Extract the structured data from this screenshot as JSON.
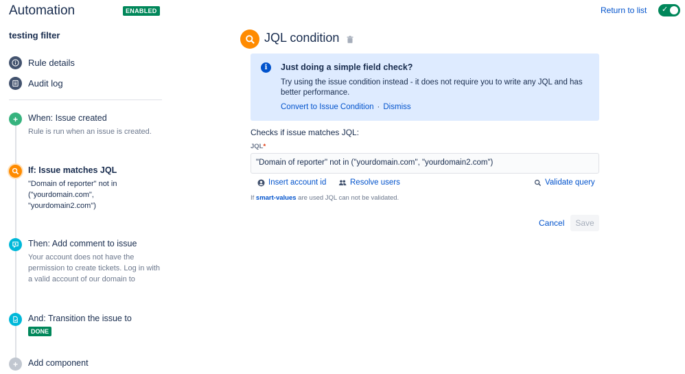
{
  "header": {
    "title": "Automation",
    "status_badge": "ENABLED",
    "return_link": "Return to list",
    "toggle_on": true
  },
  "rule": {
    "name": "testing filter"
  },
  "nav": {
    "items": [
      {
        "label": "Rule details",
        "icon": "info-icon"
      },
      {
        "label": "Audit log",
        "icon": "list-icon"
      }
    ]
  },
  "timeline": {
    "steps": [
      {
        "title": "When: Issue created",
        "desc": "Rule is run when an issue is created.",
        "icon": "plus-icon",
        "color": "#36b37e"
      },
      {
        "title": "If: Issue matches JQL",
        "desc": "\"Domain of reporter\" not in (\"yourdomain.com\", \"yourdomain2.com\")",
        "icon": "search-icon",
        "color": "#ff8b00"
      },
      {
        "title": "Then: Add comment to issue",
        "desc": "Your account does not have the permission to create tickets. Log in with a valid account of our domain to",
        "icon": "comment-icon",
        "color": "#00b8d9"
      },
      {
        "title": "And: Transition the issue to",
        "badge": "DONE",
        "icon": "document-icon",
        "color": "#00b8d9"
      },
      {
        "title": "Add component",
        "icon": "plus-icon",
        "color": "#c1c7d0"
      }
    ]
  },
  "panel": {
    "title": "JQL condition",
    "info": {
      "title": "Just doing a simple field check?",
      "text": "Try using the issue condition instead - it does not require you to write any JQL and has better performance.",
      "convert_link": "Convert to Issue Condition",
      "separator": "·",
      "dismiss_link": "Dismiss"
    },
    "checks_label": "Checks if issue matches JQL:",
    "jql_label": "JQL",
    "jql_required_mark": "*",
    "jql_value": "\"Domain of reporter\" not in (\"yourdomain.com\", \"yourdomain2.com\")",
    "insert_account_id": "Insert account id",
    "resolve_users": "Resolve users",
    "validate_query": "Validate query",
    "smart_note_prefix": "If ",
    "smart_note_link": "smart-values",
    "smart_note_suffix": " are used JQL can not be validated.",
    "cancel": "Cancel",
    "save": "Save"
  },
  "colors": {
    "accent": "#0052cc",
    "success": "#00875a",
    "warning": "#ff8b00",
    "info_bg": "#deebff"
  }
}
